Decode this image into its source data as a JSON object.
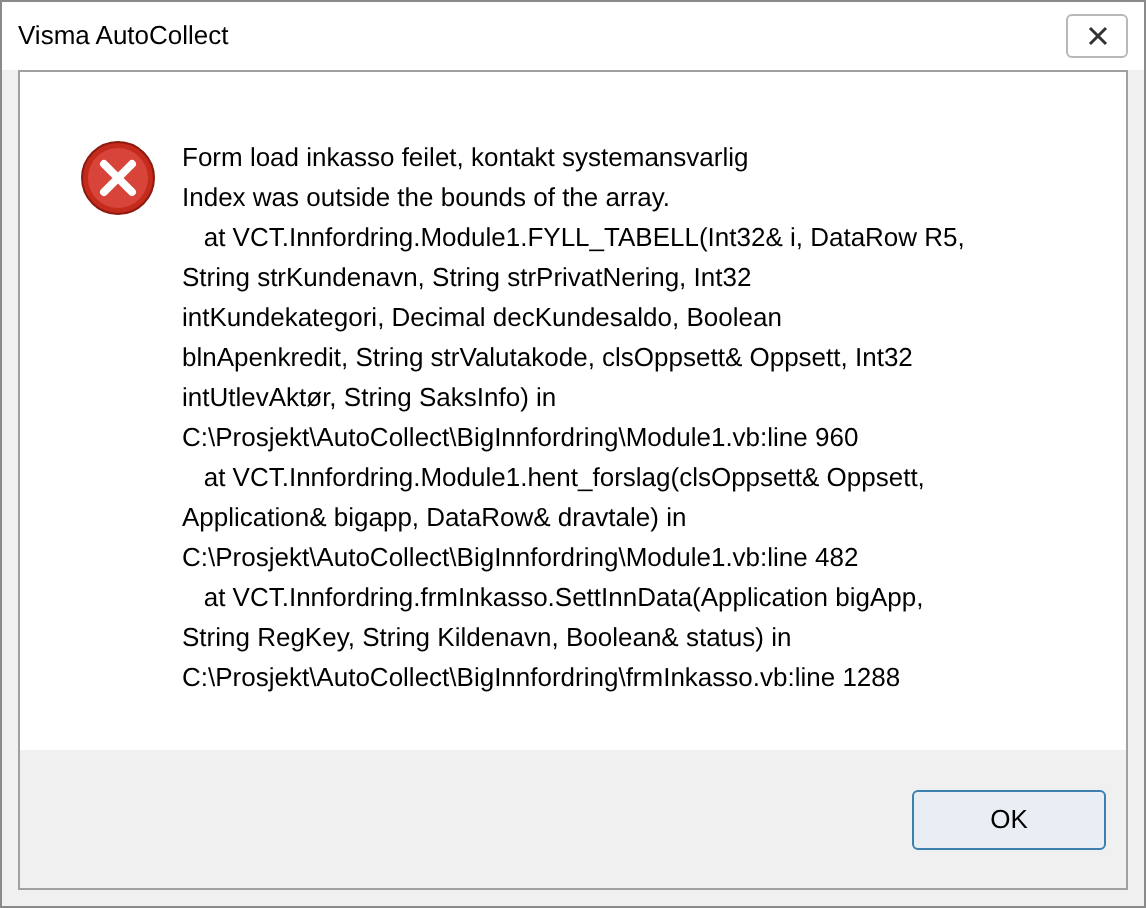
{
  "window": {
    "title": "Visma AutoCollect"
  },
  "message": {
    "lines": [
      "Form load inkasso feilet, kontakt systemansvarlig",
      "Index was outside the bounds of the array.",
      "   at VCT.Innfordring.Module1.FYLL_TABELL(Int32& i, DataRow R5,",
      "String strKundenavn, String strPrivatNering, Int32",
      "intKundekategori, Decimal decKundesaldo, Boolean",
      "blnApenkredit, String strValutakode, clsOppsett& Oppsett, Int32",
      "intUtlevAktør, String SaksInfo) in",
      "C:\\Prosjekt\\AutoCollect\\BigInnfordring\\Module1.vb:line 960",
      "   at VCT.Innfordring.Module1.hent_forslag(clsOppsett& Oppsett,",
      "Application& bigapp, DataRow& dravtale) in",
      "C:\\Prosjekt\\AutoCollect\\BigInnfordring\\Module1.vb:line 482",
      "   at VCT.Innfordring.frmInkasso.SettInnData(Application bigApp,",
      "String RegKey, String Kildenavn, Boolean& status) in",
      "C:\\Prosjekt\\AutoCollect\\BigInnfordring\\frmInkasso.vb:line 1288"
    ]
  },
  "buttons": [
    "OK"
  ]
}
